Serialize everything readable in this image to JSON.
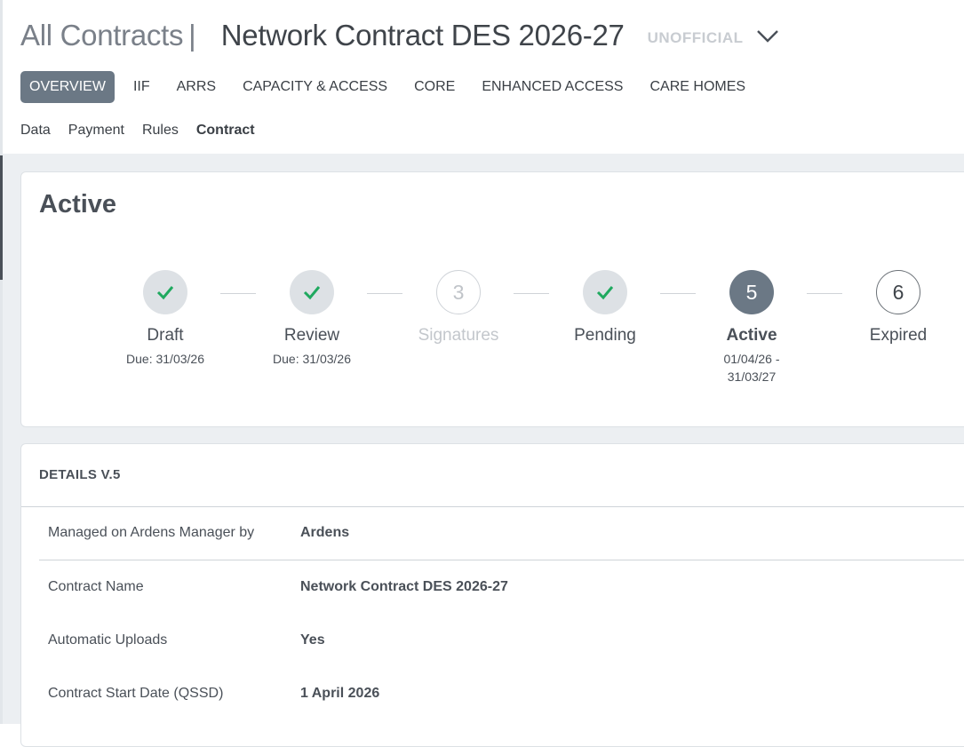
{
  "header": {
    "breadcrumb": "All Contracts",
    "separator": "|",
    "title": "Network Contract DES 2026-27",
    "status_tag": "UNOFFICIAL",
    "dropdown_icon": "chevron-down-icon"
  },
  "primary_tabs": [
    "OVERVIEW",
    "IIF",
    "ARRS",
    "CAPACITY & ACCESS",
    "CORE",
    "ENHANCED ACCESS",
    "CARE HOMES"
  ],
  "primary_active": "OVERVIEW",
  "sub_tabs": [
    "Data",
    "Payment",
    "Rules",
    "Contract"
  ],
  "sub_active": "Contract",
  "status_card": {
    "heading": "Active",
    "steps": [
      {
        "label": "Draft",
        "state": "done",
        "icon": "check-icon",
        "sub": [
          "Due: 31/03/26"
        ]
      },
      {
        "label": "Review",
        "state": "done",
        "icon": "check-icon",
        "sub": [
          "Due: 31/03/26"
        ]
      },
      {
        "label": "Signatures",
        "state": "inactive",
        "number": "3",
        "sub": []
      },
      {
        "label": "Pending",
        "state": "done",
        "icon": "check-icon",
        "sub": []
      },
      {
        "label": "Active",
        "state": "current",
        "number": "5",
        "sub": [
          "01/04/26 -",
          "31/03/27"
        ]
      },
      {
        "label": "Expired",
        "state": "future",
        "number": "6",
        "sub": []
      }
    ]
  },
  "details": {
    "heading": "DETAILS V.5",
    "rows": [
      {
        "label": "Managed on Ardens Manager by",
        "value": "Ardens"
      },
      {
        "label": "Contract Name",
        "value": "Network Contract DES 2026-27"
      },
      {
        "label": "Automatic Uploads",
        "value": "Yes"
      },
      {
        "label": "Contract Start Date (QSSD)",
        "value": "1 April 2026"
      }
    ]
  },
  "colors": {
    "tab_active_bg": "#6b7885",
    "check_green": "#1fa95f",
    "underline_blue": "#2f5f82",
    "page_bg": "#eceff2"
  }
}
